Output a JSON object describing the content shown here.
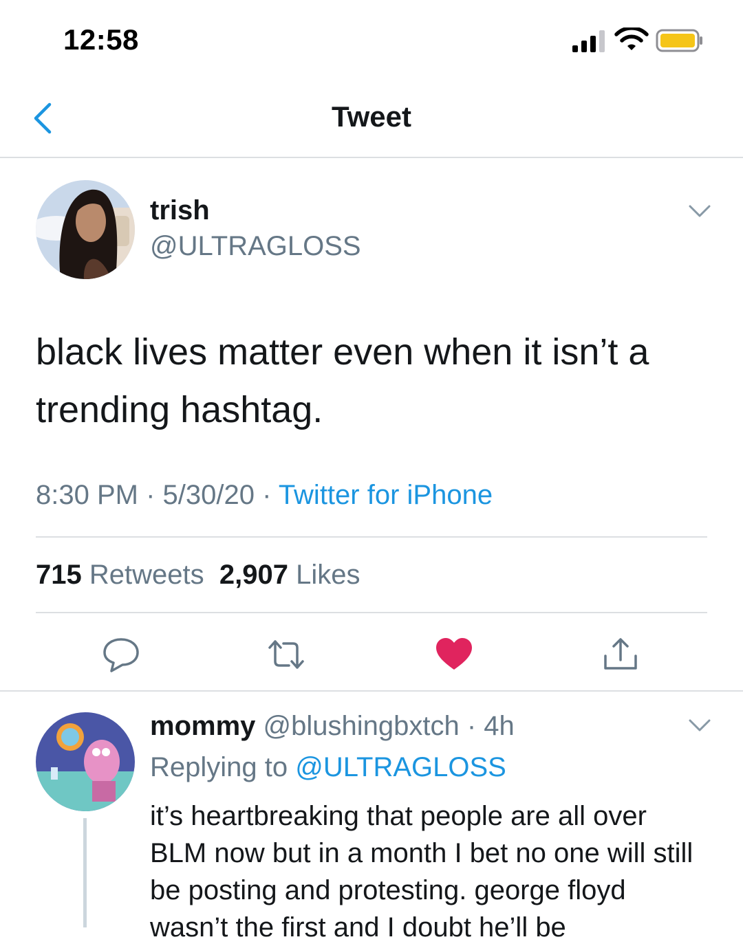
{
  "status_bar": {
    "time": "12:58",
    "signal_icon": "cellular-signal-icon",
    "wifi_icon": "wifi-icon",
    "battery_icon": "battery-icon",
    "battery_color": "#f5c518"
  },
  "nav": {
    "title": "Tweet",
    "back_icon": "chevron-left-icon"
  },
  "tweet": {
    "author_name": "trish",
    "author_handle": "@ULTRAGLOSS",
    "text": "black lives matter even when it isn’t a trending hashtag.",
    "time": "8:30 PM",
    "sep1": " · ",
    "date": "5/30/20",
    "sep2": " · ",
    "source": "Twitter for iPhone",
    "retweets_count": "715",
    "retweets_label": "Retweets",
    "likes_count": "2,907",
    "likes_label": "Likes",
    "liked": true,
    "like_color": "#e0245e",
    "accent_color": "#1b95e0"
  },
  "actions": [
    "reply-icon",
    "retweet-icon",
    "heart-icon",
    "share-icon"
  ],
  "reply": {
    "name": "mommy",
    "handle": "@blushingbxtch",
    "sep": " · ",
    "age": "4h",
    "replying_prefix": "Replying to ",
    "replying_to": "@ULTRAGLOSS",
    "text": "it’s heartbreaking that people are all over BLM now but in a month I bet no one will still be posting and protesting. george floyd wasn’t the first and I doubt he’ll be"
  }
}
